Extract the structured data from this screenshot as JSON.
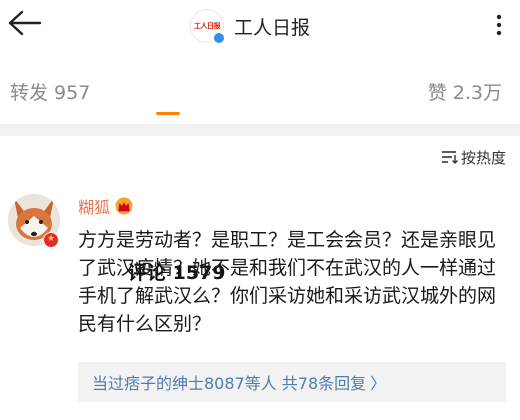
{
  "header": {
    "title": "工人日报",
    "logo_text": "工人日报"
  },
  "tabs": {
    "forward_label": "转发 957",
    "comment_label": "评论 1579",
    "like_label": "赞 2.3万"
  },
  "sort": {
    "label": "按热度"
  },
  "comment": {
    "username": "糊狐",
    "text": "方方是劳动者？是职工？是工会会员？还是亲眼见了武汉疫情？她不是和我们不在武汉的人一样通过手机了解武汉么？你们采访她和采访武汉城外的网民有什么区别？",
    "reply_summary": "当过痞子的绅士8087等人  共78条回复",
    "reply_chevron": "〉"
  },
  "colors": {
    "accent": "#ff8200",
    "username": "#eb7350",
    "link": "#507daf",
    "muted": "#8a8a8a"
  },
  "icons": [
    "back-arrow-icon",
    "more-dots-icon",
    "sort-icon",
    "crown-icon",
    "verified-icon"
  ]
}
